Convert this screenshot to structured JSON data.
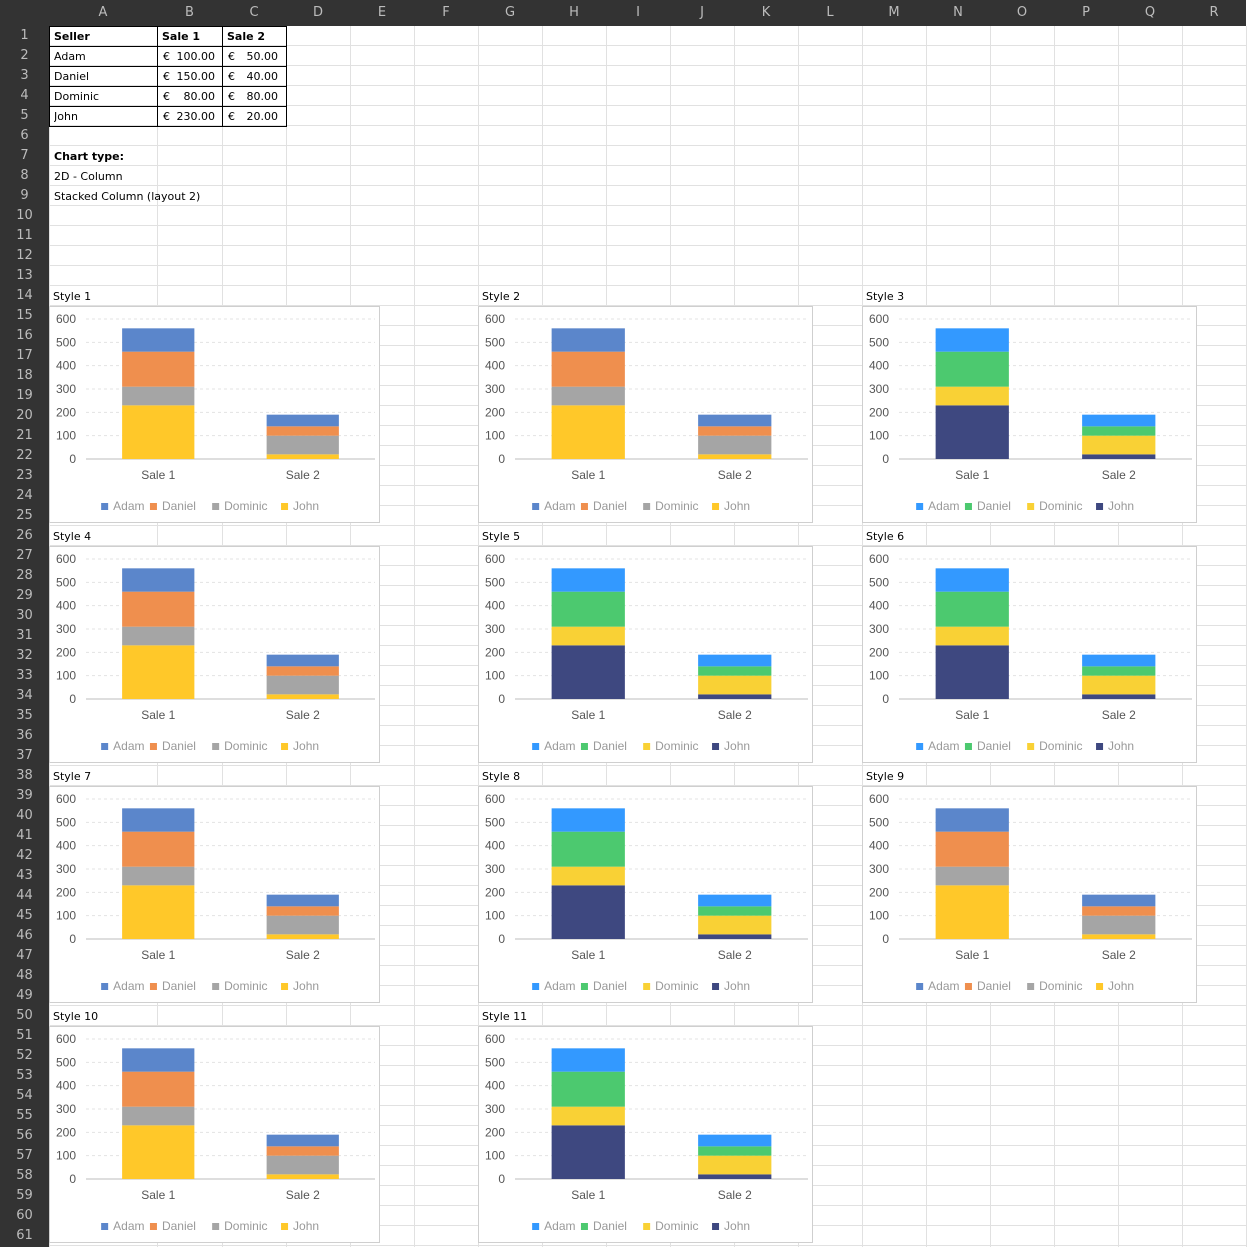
{
  "columns": [
    "A",
    "B",
    "C",
    "D",
    "E",
    "F",
    "G",
    "H",
    "I",
    "J",
    "K",
    "L",
    "M",
    "N",
    "O",
    "P",
    "Q",
    "R"
  ],
  "table": {
    "headers": [
      "Seller",
      "Sale 1",
      "Sale 2"
    ],
    "currency_symbol": "€",
    "rows": [
      {
        "seller": "Adam",
        "sale1": "100.00",
        "sale2": "50.00"
      },
      {
        "seller": "Daniel",
        "sale1": "150.00",
        "sale2": "40.00"
      },
      {
        "seller": "Dominic",
        "sale1": "80.00",
        "sale2": "80.00"
      },
      {
        "seller": "John",
        "sale1": "230.00",
        "sale2": "20.00"
      }
    ]
  },
  "notes": {
    "chart_type_label": "Chart type:",
    "chart_type_value": "2D - Column",
    "chart_layout": "Stacked Column (layout 2)"
  },
  "palettes": {
    "office": {
      "Adam": "#5b86cb",
      "Daniel": "#ef8f4e",
      "Dominic": "#a5a5a5",
      "John": "#ffc829"
    },
    "vivid": {
      "Adam": "#3399ff",
      "Daniel": "#4cc96f",
      "Dominic": "#f9d135",
      "John": "#3e4880"
    }
  },
  "chart_styles": [
    {
      "title": "Style 1",
      "palette": "office"
    },
    {
      "title": "Style 2",
      "palette": "office"
    },
    {
      "title": "Style 3",
      "palette": "vivid"
    },
    {
      "title": "Style 4",
      "palette": "office"
    },
    {
      "title": "Style 5",
      "palette": "vivid"
    },
    {
      "title": "Style 6",
      "palette": "vivid"
    },
    {
      "title": "Style 7",
      "palette": "office"
    },
    {
      "title": "Style 8",
      "palette": "vivid"
    },
    {
      "title": "Style 9",
      "palette": "office"
    },
    {
      "title": "Style 10",
      "palette": "office"
    },
    {
      "title": "Style 11",
      "palette": "vivid"
    }
  ],
  "chart_data": {
    "type": "bar",
    "stacked": true,
    "categories": [
      "Sale 1",
      "Sale 2"
    ],
    "series": [
      {
        "name": "John",
        "values": [
          230,
          20
        ]
      },
      {
        "name": "Dominic",
        "values": [
          80,
          80
        ]
      },
      {
        "name": "Daniel",
        "values": [
          150,
          40
        ]
      },
      {
        "name": "Adam",
        "values": [
          100,
          50
        ]
      }
    ],
    "legend_order": [
      "Adam",
      "Daniel",
      "Dominic",
      "John"
    ],
    "ylim": [
      0,
      600
    ],
    "yticks": [
      0,
      100,
      200,
      300,
      400,
      500,
      600
    ],
    "grid": true,
    "legend_position": "bottom"
  }
}
